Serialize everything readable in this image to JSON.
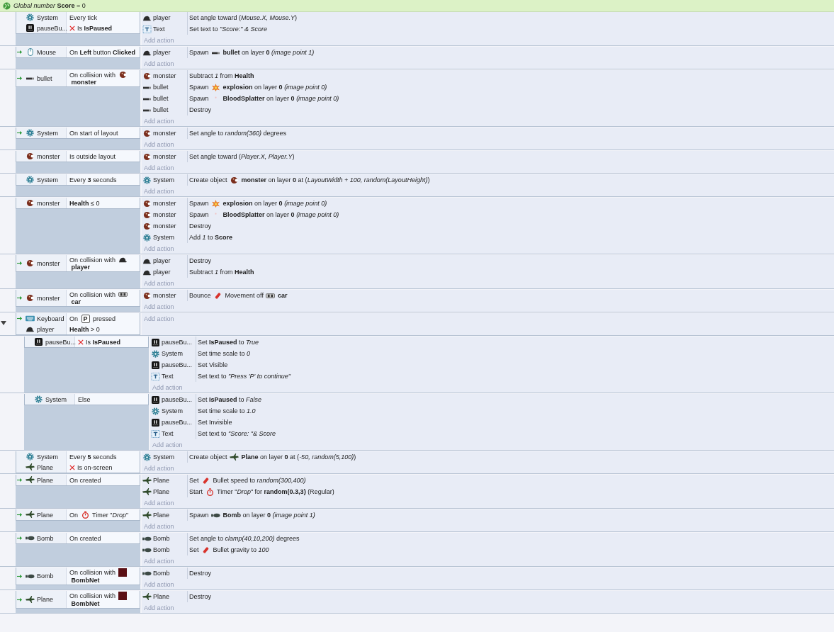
{
  "global_variable": {
    "text": "*Global number* **Score** = 0"
  },
  "events": [
    {
      "trigger": false,
      "conditions": [
        {
          "kind": "system",
          "object": "System",
          "inverted": false,
          "parts": [
            {
              "text": "Every tick"
            }
          ]
        },
        {
          "kind": "button",
          "object": "pauseBu...",
          "inverted": true,
          "parts": [
            {
              "text": "Is **IsPaused**"
            }
          ]
        }
      ],
      "actions": [
        {
          "kind": "player",
          "object": "player",
          "parts": [
            {
              "text": "Set angle toward (*Mouse.X, Mouse.Y*)"
            }
          ]
        },
        {
          "kind": "text",
          "object": "Text",
          "parts": [
            {
              "text": "Set text to *\"Score:\" & Score*"
            }
          ]
        }
      ],
      "add_action": "Add action"
    },
    {
      "trigger": true,
      "conditions": [
        {
          "kind": "mouse",
          "object": "Mouse",
          "inverted": false,
          "parts": [
            {
              "text": "On **Left** button **Clicked**"
            }
          ]
        }
      ],
      "actions": [
        {
          "kind": "player",
          "object": "player",
          "parts": [
            {
              "text": "Spawn "
            },
            {
              "kind": "bullet"
            },
            {
              "text": " **bullet** on layer **0** *(image point 1)*"
            }
          ]
        }
      ],
      "add_action": "Add action"
    },
    {
      "trigger": true,
      "conditions": [
        {
          "kind": "bullet",
          "object": "bullet",
          "inverted": false,
          "parts": [
            {
              "text": "On collision with "
            },
            {
              "kind": "monster"
            },
            {
              "text": " **monster**"
            }
          ]
        }
      ],
      "actions": [
        {
          "kind": "monster",
          "object": "monster",
          "parts": [
            {
              "text": "Subtract *1* from **Health**"
            }
          ]
        },
        {
          "kind": "bullet",
          "object": "bullet",
          "parts": [
            {
              "text": "Spawn "
            },
            {
              "kind": "explosion"
            },
            {
              "text": " **explosion** on layer **0** *(image point 0)*"
            }
          ]
        },
        {
          "kind": "bullet",
          "object": "bullet",
          "parts": [
            {
              "text": "Spawn "
            },
            {
              "kind": "blood"
            },
            {
              "text": " **BloodSplatter** on layer **0** *(image point 0)*"
            }
          ]
        },
        {
          "kind": "bullet",
          "object": "bullet",
          "parts": [
            {
              "text": "Destroy"
            }
          ]
        }
      ],
      "add_action": "Add action"
    },
    {
      "trigger": true,
      "conditions": [
        {
          "kind": "system",
          "object": "System",
          "inverted": false,
          "parts": [
            {
              "text": "On start of layout"
            }
          ]
        }
      ],
      "actions": [
        {
          "kind": "monster",
          "object": "monster",
          "parts": [
            {
              "text": "Set angle to *random(360)* degrees"
            }
          ]
        }
      ],
      "add_action": "Add action"
    },
    {
      "trigger": false,
      "conditions": [
        {
          "kind": "monster",
          "object": "monster",
          "inverted": false,
          "parts": [
            {
              "text": "Is outside layout"
            }
          ]
        }
      ],
      "actions": [
        {
          "kind": "monster",
          "object": "monster",
          "parts": [
            {
              "text": "Set angle toward (*Player.X, Player.Y*)"
            }
          ]
        }
      ],
      "add_action": "Add action"
    },
    {
      "trigger": false,
      "conditions": [
        {
          "kind": "system",
          "object": "System",
          "inverted": false,
          "parts": [
            {
              "text": "Every **3** seconds"
            }
          ]
        }
      ],
      "actions": [
        {
          "kind": "system",
          "object": "System",
          "parts": [
            {
              "text": "Create object "
            },
            {
              "kind": "monster"
            },
            {
              "text": " **monster** on layer **0** at (*LayoutWidth + 100, random(LayoutHeight)*)"
            }
          ]
        }
      ],
      "add_action": "Add action"
    },
    {
      "trigger": false,
      "conditions": [
        {
          "kind": "monster",
          "object": "monster",
          "inverted": false,
          "parts": [
            {
              "text": "**Health** ≤ 0"
            }
          ]
        }
      ],
      "actions": [
        {
          "kind": "monster",
          "object": "monster",
          "parts": [
            {
              "text": "Spawn "
            },
            {
              "kind": "explosion"
            },
            {
              "text": " **explosion** on layer **0** *(image point 0)*"
            }
          ]
        },
        {
          "kind": "monster",
          "object": "monster",
          "parts": [
            {
              "text": "Spawn "
            },
            {
              "kind": "blood"
            },
            {
              "text": " **BloodSplatter** on layer **0** *(image point 0)*"
            }
          ]
        },
        {
          "kind": "monster",
          "object": "monster",
          "parts": [
            {
              "text": "Destroy"
            }
          ]
        },
        {
          "kind": "system",
          "object": "System",
          "parts": [
            {
              "text": "Add *1* to **Score**"
            }
          ]
        }
      ],
      "add_action": "Add action"
    },
    {
      "trigger": true,
      "conditions": [
        {
          "kind": "monster",
          "object": "monster",
          "inverted": false,
          "parts": [
            {
              "text": "On collision with "
            },
            {
              "kind": "player"
            },
            {
              "text": " **player**"
            }
          ]
        }
      ],
      "actions": [
        {
          "kind": "player",
          "object": "player",
          "parts": [
            {
              "text": "Destroy"
            }
          ]
        },
        {
          "kind": "player",
          "object": "player",
          "parts": [
            {
              "text": "Subtract *1* from **Health**"
            }
          ]
        }
      ],
      "add_action": "Add action"
    },
    {
      "trigger": true,
      "conditions": [
        {
          "kind": "monster",
          "object": "monster",
          "inverted": false,
          "parts": [
            {
              "text": "On collision with "
            },
            {
              "kind": "car"
            },
            {
              "text": " **car**"
            }
          ]
        }
      ],
      "actions": [
        {
          "kind": "monster",
          "object": "monster",
          "parts": [
            {
              "text": "Bounce "
            },
            {
              "kind": "behavior"
            },
            {
              "text": " Movement off "
            },
            {
              "kind": "car"
            },
            {
              "text": " **car**"
            }
          ]
        }
      ],
      "add_action": "Add action"
    },
    {
      "trigger": true,
      "expanded": true,
      "conditions": [
        {
          "kind": "keyboard",
          "object": "Keyboard",
          "inverted": false,
          "parts": [
            {
              "text": "On "
            },
            {
              "key": "P"
            },
            {
              "text": " pressed"
            }
          ]
        },
        {
          "kind": "player",
          "object": "player",
          "inverted": false,
          "parts": [
            {
              "text": "**Health** > 0"
            }
          ]
        }
      ],
      "add_action": "Add action",
      "children": [
        {
          "trigger": false,
          "conditions": [
            {
              "kind": "button",
              "object": "pauseBu...",
              "inverted": true,
              "parts": [
                {
                  "text": "Is **IsPaused**"
                }
              ]
            }
          ],
          "actions": [
            {
              "kind": "button",
              "object": "pauseBu...",
              "parts": [
                {
                  "text": "Set **IsPaused** to *True*"
                }
              ]
            },
            {
              "kind": "system",
              "object": "System",
              "parts": [
                {
                  "text": "Set time scale to *0*"
                }
              ]
            },
            {
              "kind": "button",
              "object": "pauseBu...",
              "parts": [
                {
                  "text": "Set Visible"
                }
              ]
            },
            {
              "kind": "text",
              "object": "Text",
              "parts": [
                {
                  "text": "Set text to *\"Press 'P' to continue\"*"
                }
              ]
            }
          ],
          "add_action": "Add action"
        },
        {
          "trigger": false,
          "conditions": [
            {
              "kind": "system",
              "object": "System",
              "inverted": false,
              "parts": [
                {
                  "text": "Else"
                }
              ]
            }
          ],
          "actions": [
            {
              "kind": "button",
              "object": "pauseBu...",
              "parts": [
                {
                  "text": "Set **IsPaused** to *False*"
                }
              ]
            },
            {
              "kind": "system",
              "object": "System",
              "parts": [
                {
                  "text": "Set time scale to *1.0*"
                }
              ]
            },
            {
              "kind": "button",
              "object": "pauseBu...",
              "parts": [
                {
                  "text": "Set Invisible"
                }
              ]
            },
            {
              "kind": "text",
              "object": "Text",
              "parts": [
                {
                  "text": "Set text to *\"Score: \"& Score*"
                }
              ]
            }
          ],
          "add_action": "Add action"
        }
      ]
    },
    {
      "trigger": false,
      "conditions": [
        {
          "kind": "system",
          "object": "System",
          "inverted": false,
          "parts": [
            {
              "text": "Every **5** seconds"
            }
          ]
        },
        {
          "kind": "plane",
          "object": "Plane",
          "inverted": true,
          "parts": [
            {
              "text": "Is on-screen"
            }
          ]
        }
      ],
      "actions": [
        {
          "kind": "system",
          "object": "System",
          "parts": [
            {
              "text": "Create object "
            },
            {
              "kind": "plane"
            },
            {
              "text": " **Plane** on layer **0** at (*-50, random(5,100)*)"
            }
          ]
        }
      ],
      "add_action": "Add action"
    },
    {
      "trigger": true,
      "conditions": [
        {
          "kind": "plane",
          "object": "Plane",
          "inverted": false,
          "parts": [
            {
              "text": "On created"
            }
          ]
        }
      ],
      "actions": [
        {
          "kind": "plane",
          "object": "Plane",
          "parts": [
            {
              "text": "Set "
            },
            {
              "kind": "behavior"
            },
            {
              "text": " Bullet speed to *random(300,400)*"
            }
          ]
        },
        {
          "kind": "plane",
          "object": "Plane",
          "parts": [
            {
              "text": "Start "
            },
            {
              "kind": "timer"
            },
            {
              "text": " Timer \"*Drop*\" for **random(0.3,3)** (Regular)"
            }
          ]
        }
      ],
      "add_action": "Add action"
    },
    {
      "trigger": true,
      "conditions": [
        {
          "kind": "plane",
          "object": "Plane",
          "inverted": false,
          "parts": [
            {
              "text": "On "
            },
            {
              "kind": "timer"
            },
            {
              "text": " Timer \"*Drop*\""
            }
          ]
        }
      ],
      "actions": [
        {
          "kind": "plane",
          "object": "Plane",
          "parts": [
            {
              "text": "Spawn "
            },
            {
              "kind": "bomb"
            },
            {
              "text": " **Bomb** on layer **0** *(image point 1)*"
            }
          ]
        }
      ],
      "add_action": "Add action"
    },
    {
      "trigger": true,
      "conditions": [
        {
          "kind": "bomb",
          "object": "Bomb",
          "inverted": false,
          "parts": [
            {
              "text": "On created"
            }
          ]
        }
      ],
      "actions": [
        {
          "kind": "bomb",
          "object": "Bomb",
          "parts": [
            {
              "text": "Set angle to *clamp(40,10,200)* degrees"
            }
          ]
        },
        {
          "kind": "bomb",
          "object": "Bomb",
          "parts": [
            {
              "text": "Set "
            },
            {
              "kind": "behavior"
            },
            {
              "text": " Bullet gravity to *100*"
            }
          ]
        }
      ],
      "add_action": "Add action"
    },
    {
      "trigger": true,
      "conditions": [
        {
          "kind": "bomb",
          "object": "Bomb",
          "inverted": false,
          "parts": [
            {
              "text": "On collision with "
            },
            {
              "kind": "bombnet"
            },
            {
              "text": " **BombNet**"
            }
          ]
        }
      ],
      "actions": [
        {
          "kind": "bomb",
          "object": "Bomb",
          "parts": [
            {
              "text": "Destroy"
            }
          ]
        }
      ],
      "add_action": "Add action"
    },
    {
      "trigger": true,
      "conditions": [
        {
          "kind": "plane",
          "object": "Plane",
          "inverted": false,
          "parts": [
            {
              "text": "On collision with "
            },
            {
              "kind": "bombnet"
            },
            {
              "text": " **BombNet**"
            }
          ]
        }
      ],
      "actions": [
        {
          "kind": "plane",
          "object": "Plane",
          "parts": [
            {
              "text": "Destroy"
            }
          ]
        }
      ],
      "add_action": "Add action"
    }
  ]
}
